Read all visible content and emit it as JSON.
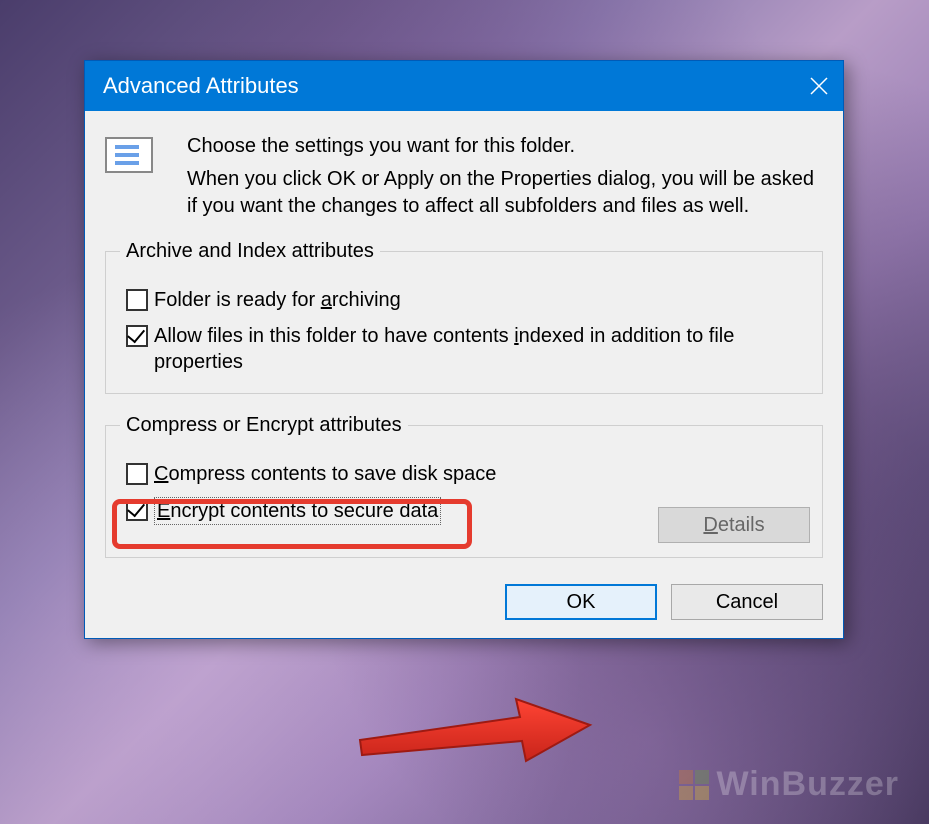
{
  "dialog": {
    "title": "Advanced Attributes",
    "intro_line1": "Choose the settings you want for this folder.",
    "intro_line2": "When you click OK or Apply on the Properties dialog, you will be asked if you want the changes to affect all subfolders and files as well."
  },
  "group1": {
    "legend": "Archive and Index attributes",
    "archive_pre": "Folder is ready for ",
    "archive_u": "a",
    "archive_post": "rchiving",
    "index_pre": "Allow files in this folder to have contents ",
    "index_u": "i",
    "index_post": "ndexed in addition to file properties"
  },
  "group2": {
    "legend": "Compress or Encrypt attributes",
    "compress_u": "C",
    "compress_post": "ompress contents to save disk space",
    "encrypt_u": "E",
    "encrypt_post": "ncrypt contents to secure data",
    "details_u": "D",
    "details_post": "etails"
  },
  "buttons": {
    "ok": "OK",
    "cancel": "Cancel"
  },
  "watermark": "WinBuzzer"
}
